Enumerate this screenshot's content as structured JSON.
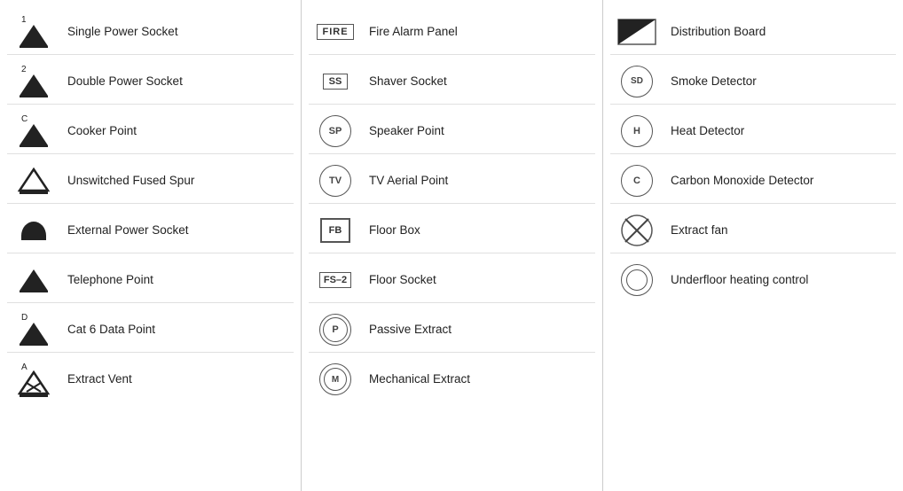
{
  "columns": [
    {
      "items": [
        {
          "id": "single-power-socket",
          "label": "Single Power Socket",
          "superscript": "1"
        },
        {
          "id": "double-power-socket",
          "label": "Double Power Socket",
          "superscript": "2"
        },
        {
          "id": "cooker-point",
          "label": "Cooker Point",
          "superscript": "C"
        },
        {
          "id": "unswitched-fused-spur",
          "label": "Unswitched Fused Spur",
          "superscript": ""
        },
        {
          "id": "external-power-socket",
          "label": "External Power Socket",
          "superscript": ""
        },
        {
          "id": "telephone-point",
          "label": "Telephone Point",
          "superscript": ""
        },
        {
          "id": "cat6-data-point",
          "label": "Cat 6 Data Point",
          "superscript": "D"
        },
        {
          "id": "extract-vent",
          "label": "Extract Vent",
          "superscript": "A"
        }
      ]
    },
    {
      "items": [
        {
          "id": "fire-alarm-panel",
          "label": "Fire Alarm Panel",
          "symbol": "FIRE"
        },
        {
          "id": "shaver-socket",
          "label": "Shaver Socket",
          "symbol": "SS"
        },
        {
          "id": "speaker-point",
          "label": "Speaker Point",
          "symbol": "SP"
        },
        {
          "id": "tv-aerial-point",
          "label": "TV Aerial Point",
          "symbol": "TV"
        },
        {
          "id": "floor-box",
          "label": "Floor Box",
          "symbol": "FB"
        },
        {
          "id": "floor-socket",
          "label": "Floor Socket",
          "symbol": "FS-2"
        },
        {
          "id": "passive-extract",
          "label": "Passive Extract",
          "symbol": "P"
        },
        {
          "id": "mechanical-extract",
          "label": "Mechanical Extract",
          "symbol": "M"
        }
      ]
    },
    {
      "items": [
        {
          "id": "distribution-board",
          "label": "Distribution Board"
        },
        {
          "id": "smoke-detector",
          "label": "Smoke Detector",
          "symbol": "SD"
        },
        {
          "id": "heat-detector",
          "label": "Heat Detector",
          "symbol": "H"
        },
        {
          "id": "carbon-monoxide-detector",
          "label": "Carbon Monoxide Detector",
          "symbol": "C"
        },
        {
          "id": "extract-fan",
          "label": "Extract fan"
        },
        {
          "id": "underfloor-heating-control",
          "label": "Underfloor heating control"
        }
      ]
    }
  ]
}
